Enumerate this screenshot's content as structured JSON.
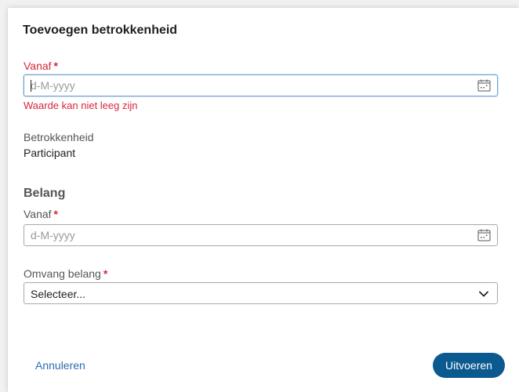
{
  "dialog": {
    "title": "Toevoegen betrokkenheid"
  },
  "first_date": {
    "label": "Vanaf",
    "required_mark": "*",
    "placeholder": "d-M-yyyy",
    "error": "Waarde kan niet leeg zijn"
  },
  "betrokkenheid": {
    "label": "Betrokkenheid",
    "value": "Participant"
  },
  "belang": {
    "heading": "Belang",
    "date_label": "Vanaf",
    "date_required_mark": "*",
    "date_placeholder": "d-M-yyyy",
    "omvang_label": "Omvang belang",
    "omvang_required_mark": "*",
    "omvang_selected": "Selecteer..."
  },
  "actions": {
    "cancel_label": "Annuleren",
    "submit_label": "Uitvoeren"
  },
  "colors": {
    "error": "#d7263d",
    "primary": "#0b5a8f",
    "link": "#2b6cb0"
  },
  "icons": {
    "date_picker": "calendar-icon",
    "dropdown": "chevron-down-icon"
  }
}
